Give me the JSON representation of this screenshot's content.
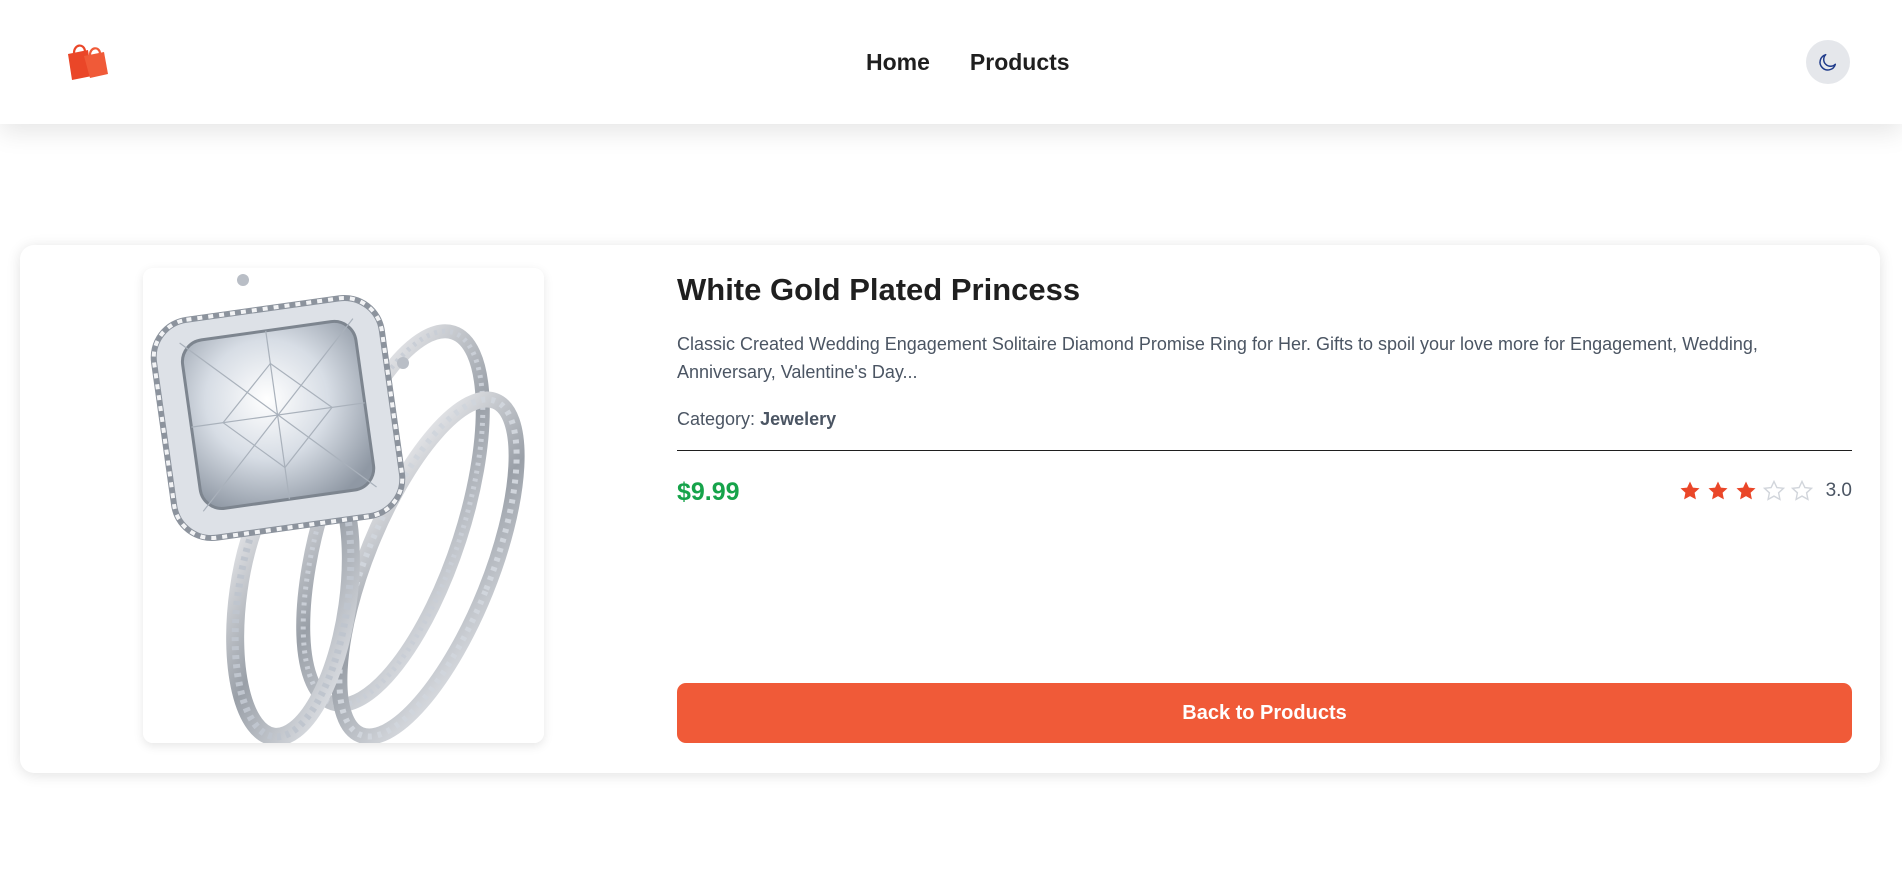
{
  "header": {
    "logo_icon": "shopping-bags-icon",
    "nav": [
      {
        "label": "Home"
      },
      {
        "label": "Products"
      }
    ],
    "theme_toggle_icon": "moon-icon"
  },
  "product": {
    "title": "White Gold Plated Princess",
    "description": "Classic Created Wedding Engagement Solitaire Diamond Promise Ring for Her. Gifts to spoil your love more for Engagement, Wedding, Anniversary, Valentine's Day...",
    "category_label": "Category:",
    "category_value": "Jewelery",
    "price": "$9.99",
    "rating": {
      "value": 3.0,
      "max": 5,
      "display": "3.0"
    },
    "image_icon": "diamond-ring-image"
  },
  "actions": {
    "back_label": "Back to Products"
  },
  "colors": {
    "accent": "#f05a38",
    "price": "#16a34a",
    "star_filled": "#ea4628",
    "star_empty": "#d1d5db"
  }
}
